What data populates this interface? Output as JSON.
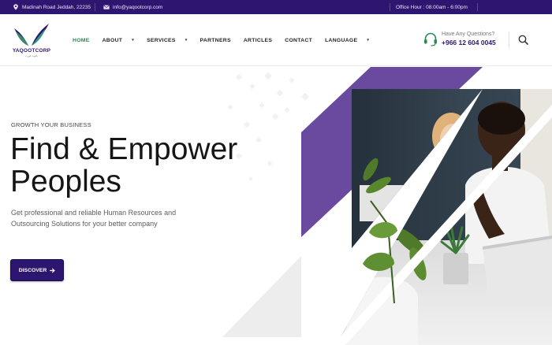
{
  "topbar": {
    "address": "Madinah Road Jeddah, 22235",
    "email": "info@yaqootcorp.com",
    "office_hours": "Office Hour : 08:00am - 6:00pm"
  },
  "brand": {
    "name": "YAQOOTCORP",
    "tagline": "ياقوت كورب",
    "colors": {
      "primary": "#2d1670",
      "accent_green": "#2a8a52",
      "purple_panel": "#6a4a9e"
    }
  },
  "nav": {
    "items": [
      {
        "label": "HOME",
        "active": true,
        "has_dropdown": false
      },
      {
        "label": "ABOUT",
        "active": false,
        "has_dropdown": true
      },
      {
        "label": "SERVICES",
        "active": false,
        "has_dropdown": true
      },
      {
        "label": "PARTNERS",
        "active": false,
        "has_dropdown": false
      },
      {
        "label": "ARTICLES",
        "active": false,
        "has_dropdown": false
      },
      {
        "label": "CONTACT",
        "active": false,
        "has_dropdown": false
      },
      {
        "label": "LANGUAGE",
        "active": false,
        "has_dropdown": true
      }
    ],
    "caret": "▾"
  },
  "contact": {
    "question": "Have Any Questions?",
    "phone": "+966 12 604 0045",
    "icon": "headset-icon"
  },
  "search": {
    "icon": "search-icon"
  },
  "hero": {
    "eyebrow": "GROWTH YOUR BUSINESS",
    "headline_line1": "Find & Empower",
    "headline_line2": "Peoples",
    "subtext": "Get professional and reliable Human Resources and Outsourcing Solutions for your better company",
    "cta_label": "DISCOVER",
    "cta_icon": "arrow-right-icon"
  }
}
